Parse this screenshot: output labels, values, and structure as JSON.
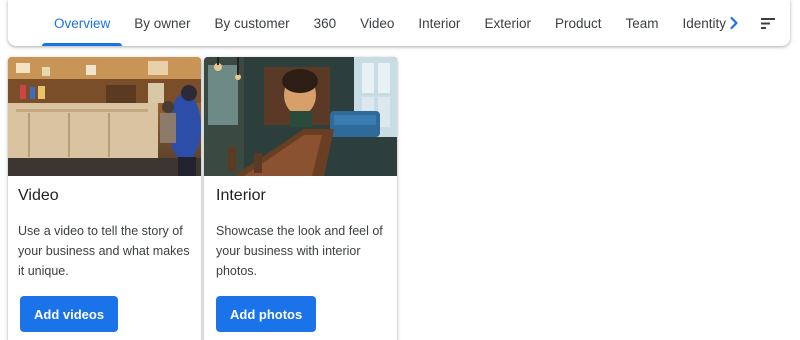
{
  "tabs": [
    {
      "label": "Overview",
      "active": true
    },
    {
      "label": "By owner"
    },
    {
      "label": "By customer"
    },
    {
      "label": "360"
    },
    {
      "label": "Video"
    },
    {
      "label": "Interior"
    },
    {
      "label": "Exterior"
    },
    {
      "label": "Product"
    },
    {
      "label": "Team"
    },
    {
      "label": "Identity"
    }
  ],
  "icons": {
    "next": "chevron-right-icon",
    "sort": "sort-icon"
  },
  "colors": {
    "accent": "#1a73e8",
    "text": "#3c4043"
  },
  "cards": [
    {
      "title": "Video",
      "description": "Use a video to tell the story of your business and what makes it unique.",
      "button": "Add videos"
    },
    {
      "title": "Interior",
      "description": "Showcase the look and feel of your business with interior photos.",
      "button": "Add photos"
    }
  ]
}
